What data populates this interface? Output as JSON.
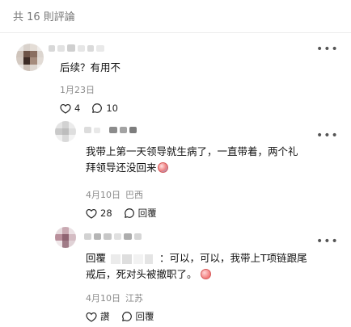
{
  "header": {
    "title": "共 16 則評論"
  },
  "comments": [
    {
      "text": "后续？有用不",
      "date": "1月23日",
      "location": "",
      "likes": "4",
      "replies": "10"
    },
    {
      "text_line1": "我带上第一天领导就生病了，一直带着，两个礼",
      "text_line2": "拜领导还没回来",
      "date": "4月10日",
      "location": "巴西",
      "likes": "28",
      "reply_label": "回覆"
    },
    {
      "reply_prefix": "回覆",
      "text_after_name": "：可以，可以，我带上T项链跟尾",
      "text_line2": "戒后，死对头被撤职了。",
      "date": "4月10日",
      "location": "江苏",
      "likes_label": "讚",
      "reply_label": "回覆"
    }
  ],
  "icons": {
    "more": "more-horizontal-icon",
    "like": "heart-outline-icon",
    "reply": "comment-bubble-icon",
    "emoji": "face-emoji-icon"
  },
  "colors": {
    "text": "#111111",
    "meta": "#8a8a8a",
    "header": "#777777",
    "divider": "#ededed"
  }
}
